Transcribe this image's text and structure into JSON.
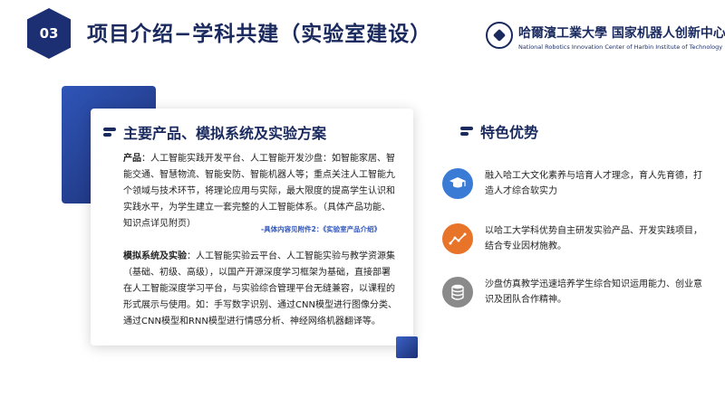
{
  "header": {
    "section_number": "03",
    "title": "项目介绍−学科共建（实验室建设）",
    "logo_cn": "哈爾濱工業大學 国家机器人创新中心",
    "logo_en": "National Robotics Innovation Center of Harbin Institute of Technology"
  },
  "products": {
    "heading": "主要产品、模拟系统及实验方案",
    "p1_label": "产品",
    "p1_text": "：人工智能实践开发平台、人工智能开发沙盘：如智能家居、智能交通、智慧物流、智能安防、智能机器人等；重点关注人工智能九个领域与技术环节，将理论应用与实际，最大限度的提高学生认识和实践水平，为学生建立一套完整的人工智能体系。（具体产品功能、知识点详见附页）",
    "p1_note": "-具体内容见附件2：《实验室产品介绍》",
    "p2_label": "模拟系统及实验",
    "p2_text": "：人工智能实验云平台、人工智能实验与教学资源集（基础、初级、高级），以国产开源深度学习框架为基础，直接部署在人工智能深度学习平台，与实验综合管理平台无缝兼容，以课程的形式展示与使用。如：手写数字识别、通过CNN模型进行图像分类、通过CNN模型和RNN模型进行情感分析、神经网络机器翻译等。"
  },
  "features": {
    "heading": "特色优势",
    "items": [
      {
        "icon": "graduation-cap-icon",
        "color": "#3a7bd5",
        "text": "融入哈工大文化素养与培育人才理念，育人先育德，打造人才综合软实力"
      },
      {
        "icon": "trend-line-icon",
        "color": "#e8742a",
        "text": "以哈工大学科优势自主研发实验产品、开发实践项目，结合专业因材施教。"
      },
      {
        "icon": "database-icon",
        "color": "#8a8a8a",
        "text": "沙盘仿真教学迅速培养学生综合知识运用能力、创业意识及团队合作精神。"
      }
    ]
  }
}
